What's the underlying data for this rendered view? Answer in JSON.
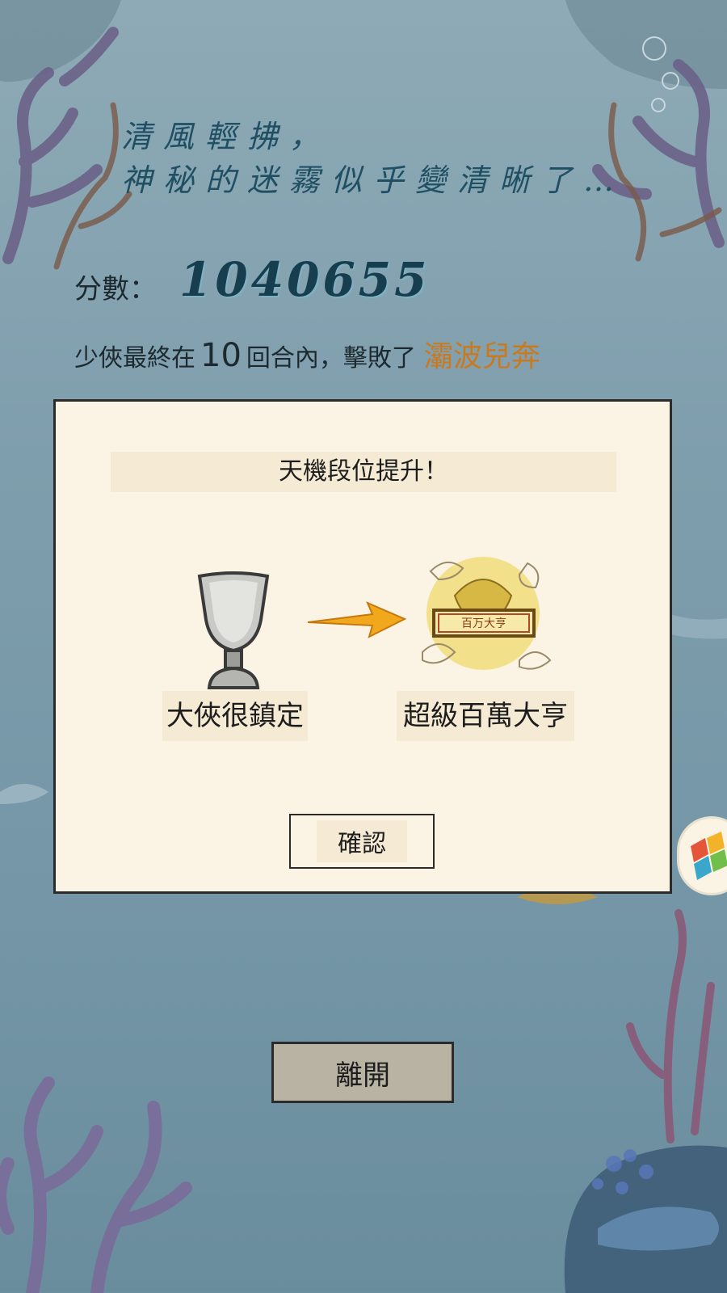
{
  "poem": {
    "line1": "清風輕拂，",
    "line2": "神秘的迷霧似乎變清晰了…"
  },
  "score": {
    "label": "分數：",
    "value": "1040655"
  },
  "result": {
    "prefix": "少俠最終在",
    "rounds": "10",
    "middle": "回合內，擊敗了",
    "boss": "灞波兒奔"
  },
  "dialog": {
    "title": "天機段位提升！",
    "old_rank": "大俠很鎮定",
    "new_rank": "超級百萬大亨",
    "new_rank_plaque": "百万大亨",
    "confirm_label": "確認"
  },
  "leave_label": "離開",
  "colors": {
    "background": "#7f9ead",
    "poem_text": "#1f4f63",
    "boss_name": "#c9791e",
    "dialog_bg": "#fbf4e4",
    "arrow": "#f2a81d"
  }
}
